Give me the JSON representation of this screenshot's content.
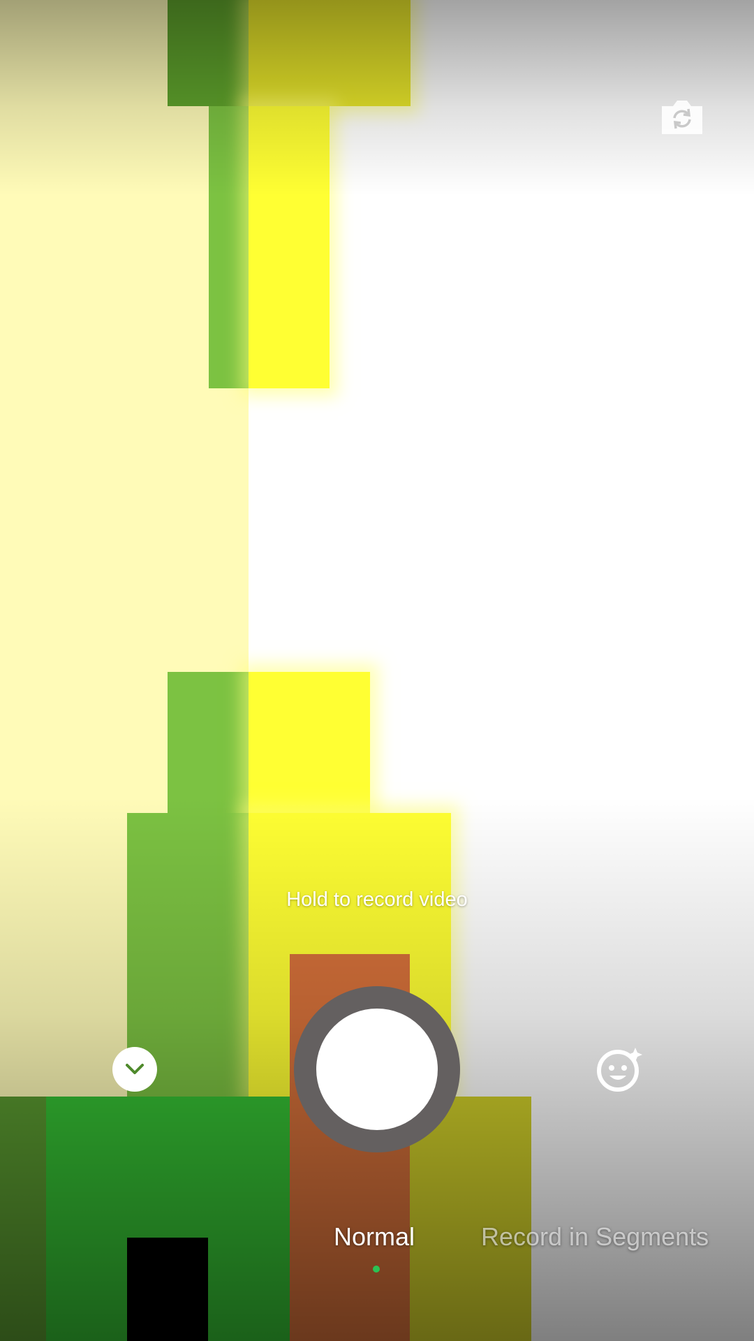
{
  "camera": {
    "hint_text": "Hold to record video",
    "flip_camera_icon": "camera-flip-icon",
    "collapse_icon": "chevron-down-icon",
    "effects_icon": "beauty-face-sparkle-icon",
    "shutter_icon": "record-shutter-icon"
  },
  "modes": {
    "items": [
      {
        "label": "Normal",
        "active": true
      },
      {
        "label": "Record in Segments",
        "active": false
      }
    ]
  },
  "colors": {
    "accent": "#2bc254",
    "shutter_ring": "#646060",
    "shutter_inner": "#ffffff"
  }
}
